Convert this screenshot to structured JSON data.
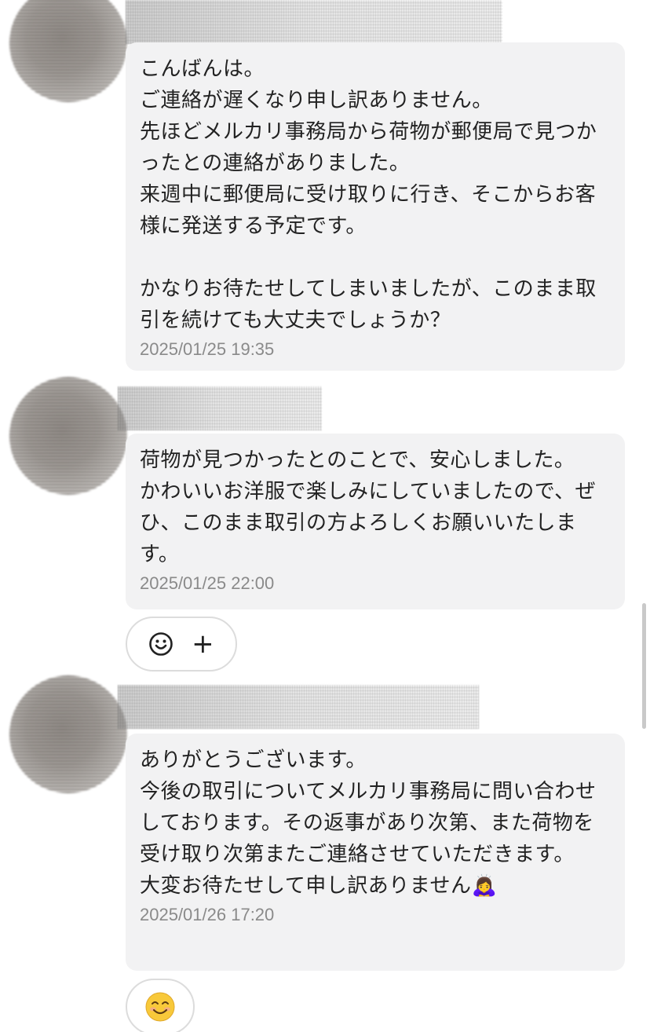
{
  "messages": [
    {
      "text": "こんばんは。\nご連絡が遅くなり申し訳ありません。\n先ほどメルカリ事務局から荷物が郵便局で見つかったとの連絡がありました。\n来週中に郵便局に受け取りに行き、そこからお客様に発送する予定です。\n\nかなりお待たせしてしまいましたが、このまま取引を続けても大丈夫でしょうか？",
      "timestamp": "2025/01/25 19:35"
    },
    {
      "text": "荷物が見つかったとのことで、安心しました。\nかわいいお洋服で楽しみにしていましたので、ぜひ、このまま取引の方よろしくお願いいたします。",
      "timestamp": "2025/01/25 22:00"
    },
    {
      "text": "ありがとうございます。\n今後の取引についてメルカリ事務局に問い合わせしております。その返事があり次第、また荷物を受け取り次第またご連絡させていただきます。\n大変お待たせして申し訳ありません🙇‍♀️",
      "timestamp": "2025/01/26 17:20"
    }
  ],
  "reaction_bar": {
    "add_icon": "smile-outline-icon",
    "plus_label": "+"
  },
  "reaction_emoji": "😊",
  "colors": {
    "bubble_bg": "#f2f2f3",
    "text": "#222222",
    "timestamp": "#8a8a8a"
  }
}
